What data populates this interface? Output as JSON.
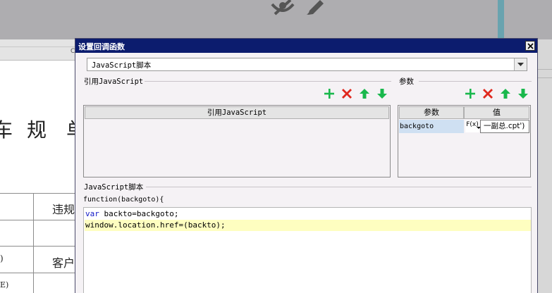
{
  "background": {
    "ruler_marker": "C",
    "heading_chars": [
      "车",
      "规",
      "单"
    ],
    "cell_texts": [
      "违规",
      "客户"
    ],
    "left_marks": [
      ")",
      "E)"
    ]
  },
  "dialog": {
    "title": "设置回调函数",
    "script_type": "JavaScript脚本",
    "ref_group_label": "引用JavaScript",
    "ref_list_header": "引用JavaScript",
    "params_group_label": "参数",
    "params": {
      "headers": [
        "参数",
        "值"
      ],
      "rows": [
        {
          "name": "backgoto",
          "fx": "F(x)",
          "value": "一副总.cpt')"
        }
      ]
    },
    "script_group_label": "JavaScript脚本",
    "function_signature": "function(backgoto){",
    "code": {
      "line1_keyword": "var",
      "line1_rest": " backto=backgoto;",
      "line2": "window.location.href=(backto);"
    }
  },
  "colors": {
    "titlebar": "#0c1c6e",
    "add_icon": "#19b84c",
    "delete_icon": "#e0281e",
    "arrow_icon": "#19b84c",
    "keyword": "#1016c6",
    "highlight_line": "#fefec0",
    "selected_row": "#cfe0f2"
  },
  "icons": [
    "hide-icon",
    "edit-icon",
    "close-icon",
    "dropdown-arrow-icon",
    "add-icon",
    "delete-icon",
    "move-up-icon",
    "move-down-icon"
  ]
}
